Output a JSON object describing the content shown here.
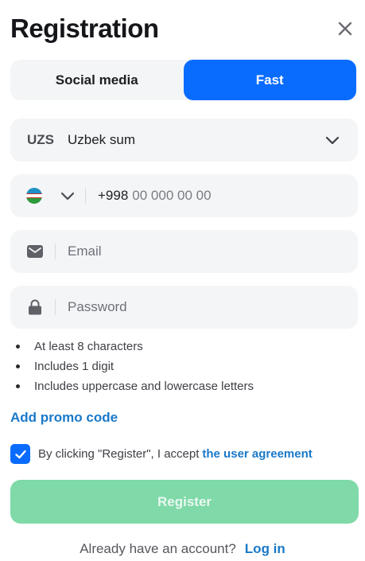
{
  "header": {
    "title": "Registration",
    "close_icon": "close-icon"
  },
  "tabs": [
    {
      "label": "Social media",
      "active": false
    },
    {
      "label": "Fast",
      "active": true
    }
  ],
  "currency": {
    "code": "UZS",
    "name": "Uzbek sum",
    "icon": "chevron-down-icon"
  },
  "phone": {
    "flag": "uzbekistan-flag-icon",
    "code": "+998",
    "placeholder": "00 000 00 00"
  },
  "email": {
    "icon": "envelope-icon",
    "placeholder": "Email"
  },
  "password": {
    "icon": "lock-icon",
    "placeholder": "Password"
  },
  "password_rules": [
    "At least 8 characters",
    "Includes 1 digit",
    "Includes uppercase and lowercase letters"
  ],
  "promo": {
    "label": "Add promo code"
  },
  "agreement": {
    "checked": true,
    "text": "By clicking \"Register\", I accept",
    "link": "the user agreement"
  },
  "register": {
    "label": "Register"
  },
  "footer": {
    "question": "Already have an account?",
    "login": "Log in"
  },
  "colors": {
    "accent": "#0a6cff",
    "link": "#1a79c9",
    "register_disabled": "#7fd9a8",
    "field_bg": "#f4f5f7"
  }
}
